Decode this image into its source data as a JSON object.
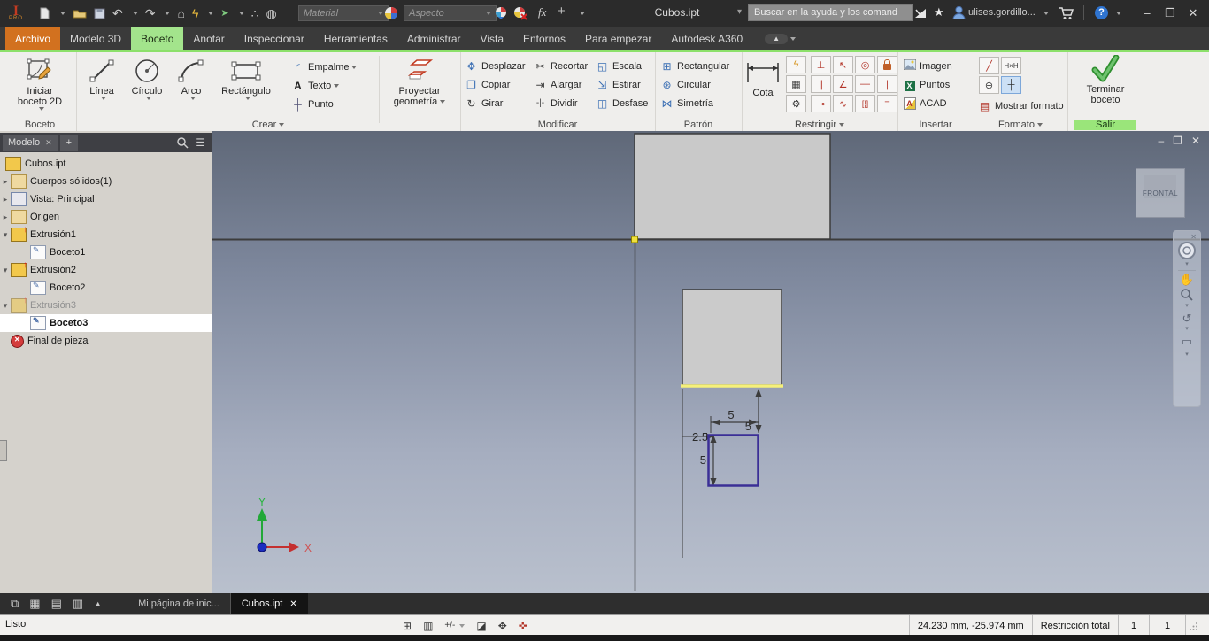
{
  "titlebar": {
    "badge_i": "I",
    "badge_pro": "PRO",
    "material_placeholder": "Material",
    "aspecto_placeholder": "Aspecto",
    "doc_title": "Cubos.ipt",
    "search_placeholder": "Buscar en la ayuda y los comand",
    "user": "ulises.gordillo...",
    "help": "?"
  },
  "tabs": [
    "Archivo",
    "Modelo 3D",
    "Boceto",
    "Anotar",
    "Inspeccionar",
    "Herramientas",
    "Administrar",
    "Vista",
    "Entornos",
    "Para empezar",
    "Autodesk A360"
  ],
  "ribbon": {
    "boceto": {
      "button": "Iniciar boceto 2D",
      "label": "Boceto"
    },
    "crear": {
      "big": [
        "Línea",
        "Círculo",
        "Arco",
        "Rectángulo"
      ],
      "small": [
        "Empalme",
        "Texto",
        "Punto"
      ],
      "proyectar_line1": "Proyectar",
      "proyectar_line2": "geometría",
      "label": "Crear"
    },
    "modificar": {
      "items": [
        "Desplazar",
        "Copiar",
        "Girar",
        "Recortar",
        "Alargar",
        "Dividir",
        "Escala",
        "Estirar",
        "Desfase"
      ],
      "label": "Modificar"
    },
    "patron": {
      "items": [
        "Rectangular",
        "Circular",
        "Simetría"
      ],
      "label": "Patrón"
    },
    "restringir": {
      "cota": "Cota",
      "label": "Restringir"
    },
    "insertar": {
      "items": [
        "Imagen",
        "Puntos",
        "ACAD"
      ],
      "label": "Insertar"
    },
    "formato": {
      "mostrar": "Mostrar formato",
      "label": "Formato"
    },
    "salir": {
      "line1": "Terminar",
      "line2": "boceto",
      "label": "Salir"
    }
  },
  "browser": {
    "tab": "Modelo",
    "items": [
      {
        "label": "Cubos.ipt"
      },
      {
        "label": "Cuerpos sólidos(1)"
      },
      {
        "label": "Vista: Principal"
      },
      {
        "label": "Origen"
      },
      {
        "label": "Extrusión1"
      },
      {
        "label": "Boceto1"
      },
      {
        "label": "Extrusión2"
      },
      {
        "label": "Boceto2"
      },
      {
        "label": "Extrusión3"
      },
      {
        "label": "Boceto3"
      },
      {
        "label": "Final de pieza"
      }
    ]
  },
  "canvas": {
    "viewcube_face": "FRONTAL",
    "dimensions": {
      "gap_v": "5",
      "width_h": "5",
      "offset": "2.5",
      "height_v": "5"
    },
    "axis": {
      "x": "X",
      "y": "Y"
    }
  },
  "doctabs": [
    "Mi página de inic...",
    "Cubos.ipt"
  ],
  "statusbar": {
    "left": "Listo",
    "coords": "24.230 mm, -25.974 mm",
    "constraint_state": "Restricción total",
    "count1": "1",
    "count2": "1"
  },
  "colors": {
    "accent_orange": "#d2711f",
    "tab_green": "#a3e48c",
    "constraint_red": "#b3362a",
    "sketch_purple": "#3b2f96",
    "highlight_yellow": "#f5f07a"
  },
  "icons": {
    "undo": "↶",
    "redo": "↷",
    "home": "⌂",
    "flash": "ϟ",
    "cursor": "➤",
    "dots": "∴",
    "globe": "◍",
    "fx": "fx",
    "plus": "+",
    "star": "★",
    "min": "–",
    "max": "❐",
    "close": "✕",
    "menu": "☰",
    "search_close": "✕",
    "tab_plus": "+",
    "move": "✥",
    "copy": "❐",
    "rotate": "↻",
    "trim": "✂",
    "extend": "⇥",
    "split": "-|-",
    "scale": "◱",
    "stretch": "⇲",
    "offset": "◫",
    "pat_rect": "⊞",
    "pat_circ": "⊛",
    "pat_sym": "⋈",
    "auto_dim": "ϟ",
    "show_con": "▦",
    "con_set": "⚙",
    "c_perp": "⊥",
    "c_coin": "↖",
    "c_conc": "◎",
    "c_par": "∥",
    "c_tang2": "∠",
    "c_horz": "―",
    "c_vert": "∣",
    "c_tan": "⊸",
    "c_smooth": "∿",
    "c_sym": "[¦]",
    "c_eq": "=",
    "fmt_constr": "╱",
    "fmt_driven": "H×H",
    "fmt_center": "⊖",
    "fmt_cpoint": "┼",
    "fmt_show": "▤",
    "ins_points": "X",
    "ins_acad": "A",
    "win_cascade": "⧉",
    "win_tile": "▦",
    "win_horz": "▤",
    "win_vert": "▥",
    "win_up": "▲",
    "sb_grid": "⊞",
    "sb_scr": "▥",
    "sb_dim": "+/-",
    "sb_slice": "◪",
    "sb_pdim": "✥",
    "sb_relax": "✜",
    "nv_hand": "✋",
    "nv_orbit": "↺",
    "nv_look": "▭",
    "nv_caret": "▾",
    "nv_close": "✕",
    "texto_a": "A",
    "punto": "┼",
    "empalme": "◜"
  }
}
